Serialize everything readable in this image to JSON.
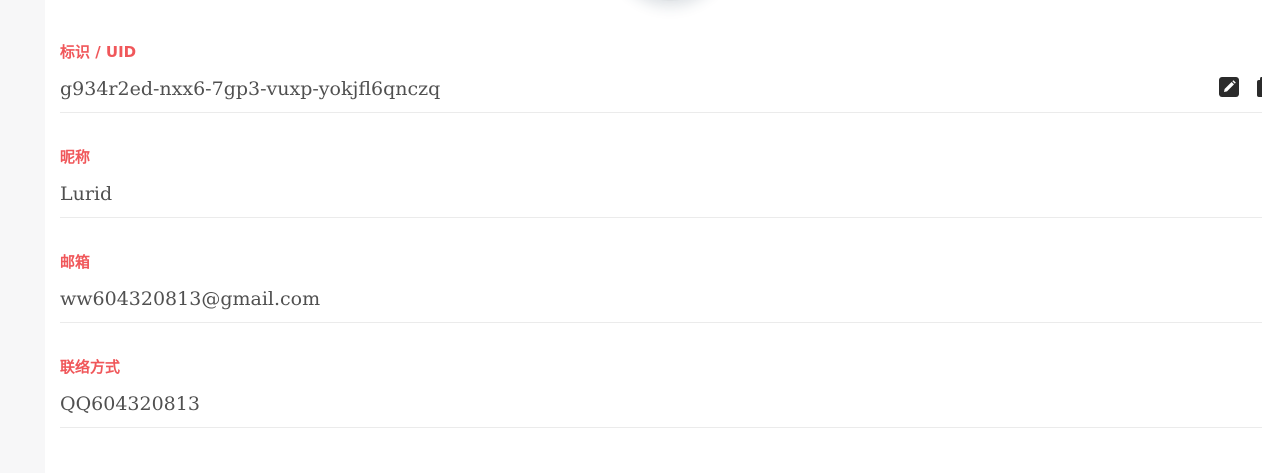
{
  "profile": {
    "uid": {
      "label": "标识 / UID",
      "value": "g934r2ed-nxx6-7gp3-vuxp-yokjfl6qnczq"
    },
    "nickname": {
      "label": "昵称",
      "value": "Lurid"
    },
    "email": {
      "label": "邮箱",
      "value": "ww604320813@gmail.com"
    },
    "contact": {
      "label": "联络方式",
      "value": "QQ604320813"
    }
  },
  "icons": {
    "edit": "edit-icon",
    "copy": "copy-icon"
  },
  "colors": {
    "label": "#f0575a",
    "value": "#505050",
    "divider": "#ebebeb",
    "icon": "#2b2b2b"
  }
}
